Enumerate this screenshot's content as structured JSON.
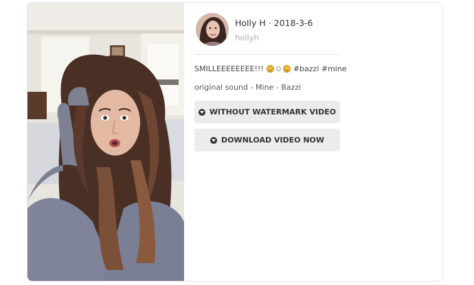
{
  "post": {
    "title": "Holly H · 2018-3-6",
    "username": "hollyh",
    "description_text": "SMILLEEEEEEEE!!!",
    "hashtags": "#bazzi #mine",
    "emojis": [
      "grinning-face-icon",
      "small-face-icon",
      "laughing-face-icon"
    ],
    "sound": "original sound - Mine - Bazzi"
  },
  "buttons": {
    "without_watermark": "WITHOUT WATERMARK VIDEO",
    "download_now": "DOWNLOAD VIDEO NOW"
  },
  "colors": {
    "button_bg": "#ececec",
    "card_border": "#e2e2e2",
    "muted_text": "#aaaaaa"
  }
}
